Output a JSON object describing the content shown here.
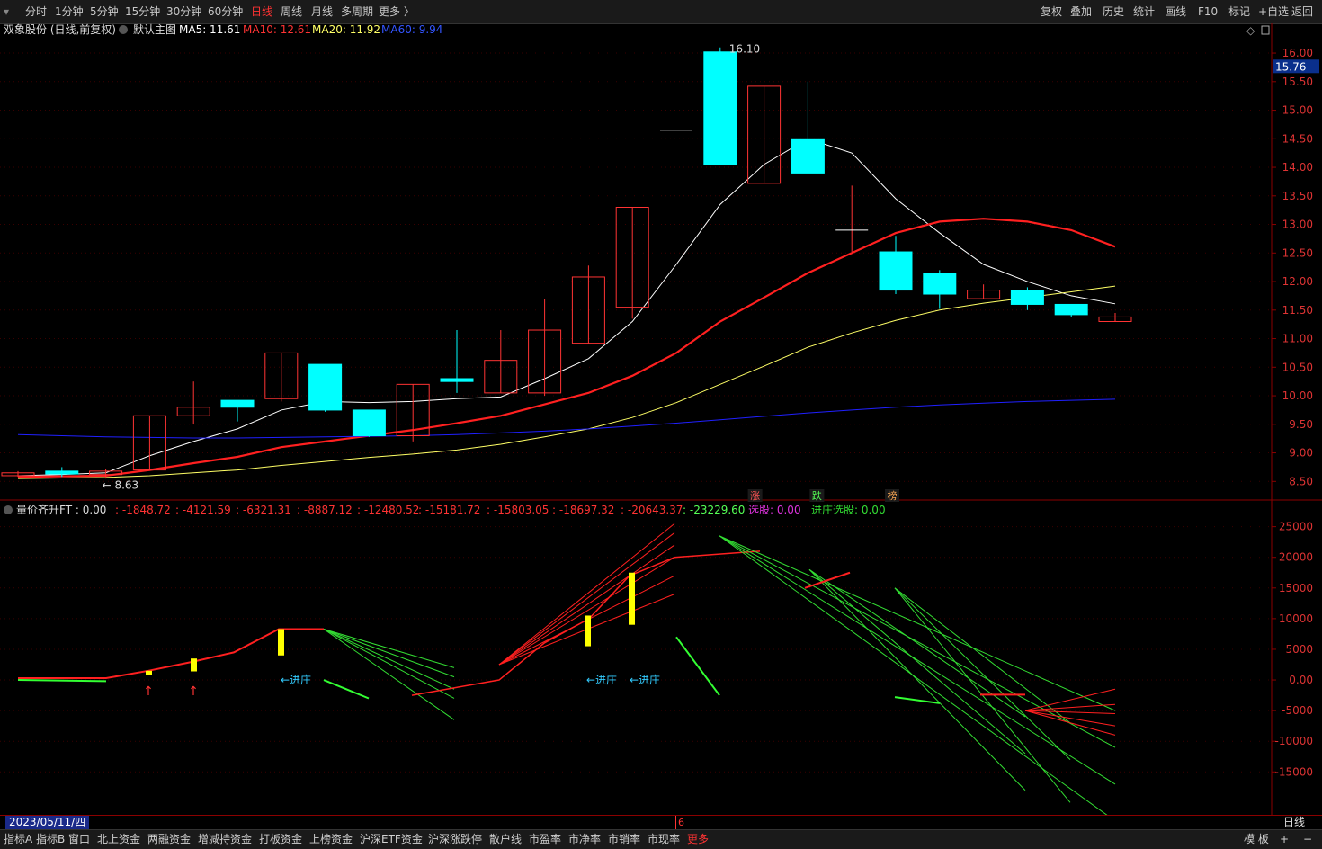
{
  "toolbar": {
    "left": [
      "分时",
      "1分钟",
      "5分钟",
      "15分钟",
      "30分钟",
      "60分钟",
      "日线",
      "周线",
      "月线",
      "多周期",
      "更多 〉"
    ],
    "active": "日线",
    "right": [
      "复权",
      "叠加",
      "历史",
      "统计",
      "画线",
      "F10",
      "标记",
      "+自选",
      "返回"
    ]
  },
  "main_info": {
    "stock": "双象股份 (日线,前复权)",
    "template": "默认主图",
    "ma5": "MA5: 11.61",
    "ma10": "MA10: 12.61",
    "ma20": "MA20: 11.92",
    "ma60": "MA60: 9.94"
  },
  "price_tag": "15.76",
  "high_label": "16.10",
  "low_label": "8.63",
  "markers": [
    "涨",
    "跌",
    "榜"
  ],
  "sub_info": {
    "name": "量价齐升FT : 0.00",
    "values": [
      ": -1848.72",
      ": -4121.59",
      ": -6321.31",
      ": -8887.12",
      ": -12480.52",
      ": -15181.72",
      ": -15803.05",
      ": -18697.32",
      ": -20643.37",
      ": -23229.60"
    ],
    "xuangu": "选股: 0.00",
    "jinzhuang": "进庄选股: 0.00"
  },
  "jinzhuang_label": "←进庄",
  "date": "2023/05/11/四",
  "bottom_cursor": "6",
  "period_label": "日线",
  "bottom_tabs": [
    "指标A",
    "指标B",
    "窗口",
    "北上资金",
    "两融资金",
    "增减持资金",
    "打板资金",
    "上榜资金",
    "沪深ETF资金",
    "沪深涨跌停",
    "散户线",
    "市盈率",
    "市净率",
    "市销率",
    "市现率",
    "更多"
  ],
  "bottom_right": [
    "模 板",
    "+",
    "−"
  ],
  "colors": {
    "up": "#ff3333",
    "down": "#00ffff",
    "ma5": "#ffffff",
    "ma10": "#ff2020",
    "ma20": "#ffff66",
    "ma60": "#2020ff",
    "bg": "#000000"
  },
  "chart_data": [
    {
      "type": "candlestick",
      "title": "双象股份 (日线,前复权)",
      "y_ticks": [
        8.5,
        9.0,
        9.5,
        10.0,
        10.5,
        11.0,
        11.5,
        12.0,
        12.5,
        13.0,
        13.5,
        14.0,
        14.5,
        15.0,
        15.5,
        16.0
      ],
      "ylim": [
        8.3,
        16.3
      ],
      "candles": [
        {
          "o": 8.6,
          "c": 8.65,
          "h": 8.68,
          "l": 8.58
        },
        {
          "o": 8.68,
          "c": 8.63,
          "h": 8.75,
          "l": 8.58
        },
        {
          "o": 8.62,
          "c": 8.68,
          "h": 8.72,
          "l": 8.55
        },
        {
          "o": 8.7,
          "c": 9.65,
          "h": 9.65,
          "l": 8.7
        },
        {
          "o": 9.65,
          "c": 9.8,
          "h": 10.25,
          "l": 9.5
        },
        {
          "o": 9.92,
          "c": 9.8,
          "h": 9.92,
          "l": 9.55
        },
        {
          "o": 9.95,
          "c": 10.75,
          "h": 10.75,
          "l": 9.9
        },
        {
          "o": 10.55,
          "c": 9.75,
          "h": 10.55,
          "l": 9.72
        },
        {
          "o": 9.75,
          "c": 9.3,
          "h": 9.75,
          "l": 9.28
        },
        {
          "o": 9.3,
          "c": 10.2,
          "h": 10.2,
          "l": 9.2
        },
        {
          "o": 10.3,
          "c": 10.25,
          "h": 11.15,
          "l": 10.05
        },
        {
          "o": 10.05,
          "c": 10.62,
          "h": 11.15,
          "l": 10.05
        },
        {
          "o": 10.05,
          "c": 11.15,
          "h": 11.7,
          "l": 10.0
        },
        {
          "o": 10.92,
          "c": 12.08,
          "h": 12.28,
          "l": 10.92
        },
        {
          "o": 11.55,
          "c": 13.3,
          "h": 13.3,
          "l": 11.35
        },
        {
          "o": 14.65,
          "c": 14.65,
          "h": 14.65,
          "l": 14.65
        },
        {
          "o": 16.02,
          "c": 14.05,
          "h": 16.1,
          "l": 14.05
        },
        {
          "o": 13.72,
          "c": 15.42,
          "h": 15.42,
          "l": 13.72
        },
        {
          "o": 14.5,
          "c": 13.9,
          "h": 15.5,
          "l": 13.9
        },
        {
          "o": 12.9,
          "c": 12.9,
          "h": 13.68,
          "l": 12.52
        },
        {
          "o": 12.52,
          "c": 11.85,
          "h": 12.8,
          "l": 11.78
        },
        {
          "o": 12.15,
          "c": 11.78,
          "h": 12.2,
          "l": 11.52
        },
        {
          "o": 11.7,
          "c": 11.85,
          "h": 11.95,
          "l": 11.7
        },
        {
          "o": 11.85,
          "c": 11.6,
          "h": 11.9,
          "l": 11.5
        },
        {
          "o": 11.6,
          "c": 11.42,
          "h": 11.6,
          "l": 11.38
        },
        {
          "o": 11.3,
          "c": 11.38,
          "h": 11.45,
          "l": 11.3
        }
      ],
      "series": [
        {
          "name": "MA5",
          "values": [
            8.6,
            8.62,
            8.65,
            8.95,
            9.2,
            9.42,
            9.75,
            9.9,
            9.88,
            9.9,
            9.95,
            9.98,
            10.3,
            10.65,
            11.3,
            12.3,
            13.35,
            14.05,
            14.5,
            14.25,
            13.45,
            12.85,
            12.3,
            12.0,
            11.75,
            11.61
          ]
        },
        {
          "name": "MA10",
          "values": [
            8.58,
            8.59,
            8.6,
            8.7,
            8.82,
            8.93,
            9.1,
            9.2,
            9.3,
            9.4,
            9.52,
            9.65,
            9.85,
            10.05,
            10.35,
            10.75,
            11.3,
            11.72,
            12.15,
            12.5,
            12.85,
            13.05,
            13.1,
            13.05,
            12.9,
            12.61
          ]
        },
        {
          "name": "MA20",
          "values": [
            8.55,
            8.56,
            8.57,
            8.6,
            8.65,
            8.7,
            8.78,
            8.85,
            8.92,
            8.98,
            9.05,
            9.15,
            9.28,
            9.42,
            9.62,
            9.88,
            10.2,
            10.52,
            10.85,
            11.1,
            11.32,
            11.5,
            11.62,
            11.72,
            11.82,
            11.92
          ]
        },
        {
          "name": "MA60",
          "values": [
            9.32,
            9.3,
            9.28,
            9.27,
            9.26,
            9.26,
            9.27,
            9.28,
            9.29,
            9.3,
            9.32,
            9.35,
            9.38,
            9.42,
            9.47,
            9.52,
            9.58,
            9.64,
            9.7,
            9.75,
            9.8,
            9.84,
            9.87,
            9.9,
            9.92,
            9.94
          ]
        }
      ]
    },
    {
      "type": "line",
      "title": "量价齐升FT",
      "y_ticks": [
        25000,
        20000,
        15000,
        10000,
        5000,
        0,
        -5000,
        -10000,
        -15000
      ],
      "ylim": [
        -22000,
        27000
      ]
    }
  ]
}
